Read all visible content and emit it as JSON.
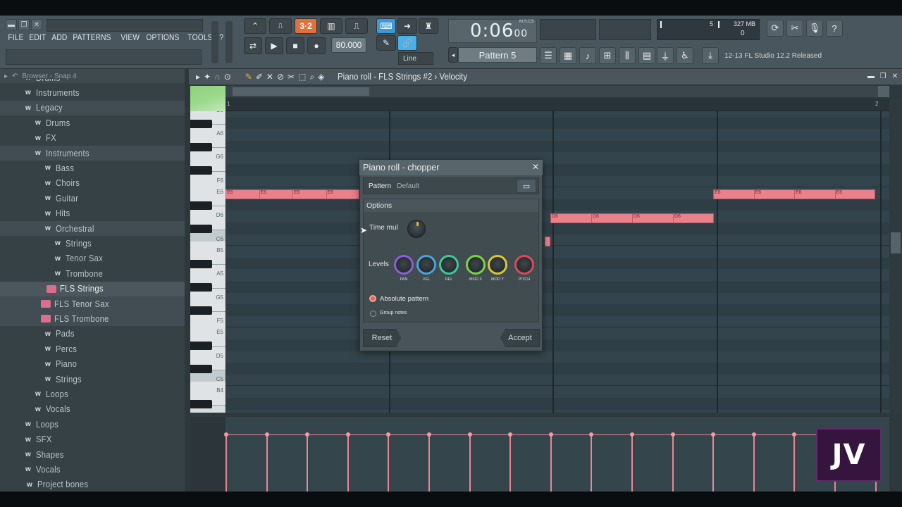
{
  "menu": {
    "items": [
      "FILE",
      "EDIT",
      "ADD",
      "PATTERNS",
      "VIEW",
      "OPTIONS",
      "TOOLS",
      "?"
    ]
  },
  "transport": {
    "pattern_song_toggle": "PAT",
    "tempo": "80.000",
    "time_main": "0:06",
    "time_sub": "00",
    "time_unit": "M:S:CS"
  },
  "snap": {
    "mode": "Line"
  },
  "pattern": {
    "selected": "Pattern 5"
  },
  "monitor": {
    "cpu": "5",
    "memory": "327 MB",
    "polyphony": "0"
  },
  "news": {
    "text": "12-13  FL Studio 12.2 Released"
  },
  "browser": {
    "header": "Browser - Snap 4",
    "items": [
      {
        "label": "Drums",
        "type": "folder",
        "indent": 1
      },
      {
        "label": "Instruments",
        "type": "folder",
        "indent": 1
      },
      {
        "label": "Legacy",
        "type": "folder",
        "indent": 1
      },
      {
        "label": "Drums",
        "type": "folder",
        "indent": 2
      },
      {
        "label": "FX",
        "type": "folder",
        "indent": 2
      },
      {
        "label": "Instruments",
        "type": "folder",
        "indent": 2
      },
      {
        "label": "Bass",
        "type": "folder",
        "indent": 3
      },
      {
        "label": "Choirs",
        "type": "folder",
        "indent": 3
      },
      {
        "label": "Guitar",
        "type": "folder",
        "indent": 3
      },
      {
        "label": "Hits",
        "type": "folder",
        "indent": 3
      },
      {
        "label": "Orchestral",
        "type": "folder",
        "indent": 3
      },
      {
        "label": "Strings",
        "type": "folder",
        "indent": 4
      },
      {
        "label": "Tenor Sax",
        "type": "folder",
        "indent": 4
      },
      {
        "label": "Trombone",
        "type": "folder",
        "indent": 4
      },
      {
        "label": "FLS Strings",
        "type": "preset",
        "indent": 4
      },
      {
        "label": "FLS Tenor Sax",
        "type": "preset",
        "indent": 3
      },
      {
        "label": "FLS Trombone",
        "type": "preset",
        "indent": 3
      },
      {
        "label": "Pads",
        "type": "folder",
        "indent": 3
      },
      {
        "label": "Percs",
        "type": "folder",
        "indent": 3
      },
      {
        "label": "Piano",
        "type": "folder",
        "indent": 3
      },
      {
        "label": "Strings",
        "type": "folder",
        "indent": 3
      },
      {
        "label": "Loops",
        "type": "folder",
        "indent": 2
      },
      {
        "label": "Vocals",
        "type": "folder",
        "indent": 2
      },
      {
        "label": "Loops",
        "type": "folder",
        "indent": 1
      },
      {
        "label": "SFX",
        "type": "folder",
        "indent": 1
      },
      {
        "label": "Shapes",
        "type": "folder",
        "indent": 1
      },
      {
        "label": "Vocals",
        "type": "folder",
        "indent": 1
      },
      {
        "label": "Project bones",
        "type": "folder",
        "indent": 0
      }
    ]
  },
  "piano_roll": {
    "title": "Piano roll - FLS Strings #2 › Velocity",
    "ruler_start": "1",
    "ruler_end": "2",
    "key_labels": [
      "B6",
      "A6",
      "G6",
      "F6",
      "E6",
      "D6",
      "C6",
      "B5",
      "A5",
      "G5",
      "F5",
      "E5",
      "D5",
      "C5",
      "B4"
    ],
    "note_label_e6": "E6",
    "note_label_d6": "D6"
  },
  "dialog": {
    "title": "Piano roll - chopper",
    "pattern_label": "Pattern",
    "pattern_value": "Default",
    "options_label": "Options",
    "time_mul_label": "Time mul",
    "levels_label": "Levels",
    "knobs": [
      {
        "label": "PAN",
        "color": "#8c5fd6"
      },
      {
        "label": "VEL",
        "color": "#4aa3d8"
      },
      {
        "label": "REL",
        "color": "#3ec79a"
      },
      {
        "label": "MOD X",
        "color": "#7dd04a"
      },
      {
        "label": "MOD Y",
        "color": "#d9c43a"
      },
      {
        "label": "PITCH",
        "color": "#d94a5a"
      }
    ],
    "absolute_pattern_label": "Absolute pattern",
    "absolute_pattern_checked": true,
    "group_notes_label": "Group notes",
    "group_notes_checked": false,
    "reset_label": "Reset",
    "accept_label": "Accept"
  },
  "logo": {
    "text": "JV"
  },
  "colors": {
    "note": "#e9818d",
    "accent_orange": "#e2703a",
    "accent_blue": "#3b9ad6",
    "green_corner": "#8fd17e"
  }
}
